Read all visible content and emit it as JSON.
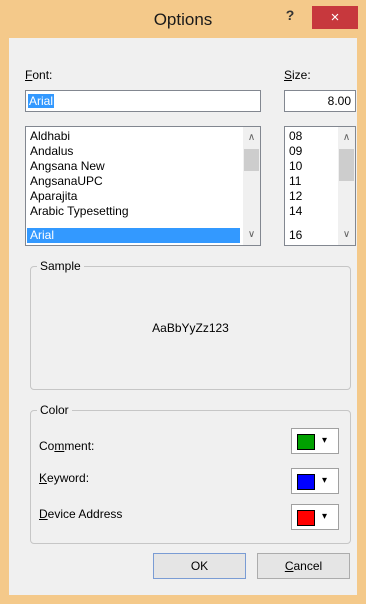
{
  "window": {
    "title": "Options",
    "help": "?",
    "close": "×"
  },
  "font": {
    "label_pre": "",
    "label_ul": "F",
    "label_post": "ont:",
    "value": "Arial",
    "list": [
      "Aldhabi",
      "Andalus",
      "Angsana New",
      "AngsanaUPC",
      "Aparajita",
      "Arabic Typesetting",
      "Arial"
    ],
    "selected_index": 6
  },
  "size": {
    "label_pre": "",
    "label_ul": "S",
    "label_post": "ize:",
    "value": "8.00",
    "list": [
      "08",
      "09",
      "10",
      "11",
      "12",
      "14",
      "16"
    ]
  },
  "sample": {
    "title": "Sample",
    "text": "AaBbYyZz123"
  },
  "color": {
    "title": "Color",
    "items": [
      {
        "pre": "Co",
        "ul": "m",
        "post": "ment:",
        "color": "#00a000",
        "icon": "dropdown-arrow"
      },
      {
        "pre": "",
        "ul": "K",
        "post": "eyword:",
        "color": "#0000ff",
        "icon": "dropdown-arrow"
      },
      {
        "pre": "",
        "ul": "D",
        "post": "evice Address",
        "color": "#ff0000",
        "icon": "dropdown-arrow"
      }
    ]
  },
  "buttons": {
    "ok": "OK",
    "cancel_ul": "C",
    "cancel_post": "ancel"
  },
  "glyphs": {
    "up": "∧",
    "down": "∨",
    "dropdown": "▾"
  }
}
